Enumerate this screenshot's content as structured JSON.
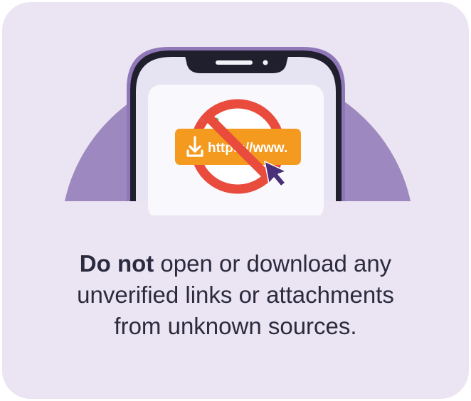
{
  "colors": {
    "card_bg": "#ebe4f2",
    "arc_purple": "#9d88bf",
    "phone_frame": "#1f1f2e",
    "phone_outline": "#8f77b8",
    "screen_bg": "#e6e4f3",
    "inner_panel": "#f8f8fd",
    "url_bar": "#f39a1f",
    "prohibit_red": "#e94b3c",
    "cursor": "#4a2f7a",
    "text": "#2b2b3f",
    "dot_red": "#e6524a",
    "dot_yellow": "#f1c232",
    "dot_green": "#5fbf67"
  },
  "illustration": {
    "url_text": "https://www.",
    "icons": [
      "download-icon",
      "prohibited-icon",
      "cursor-icon"
    ]
  },
  "message": {
    "bold": "Do not",
    "line1_rest": " open or download any",
    "line2": "unverified links or attachments",
    "line3": "from unknown sources."
  }
}
